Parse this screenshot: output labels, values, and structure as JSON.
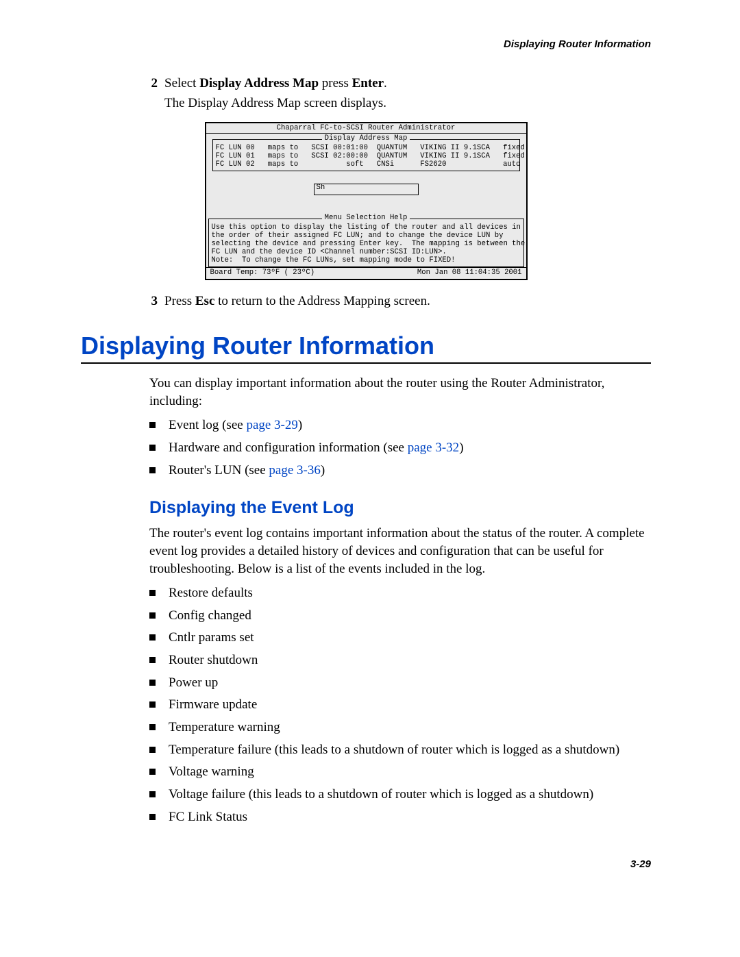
{
  "header": {
    "running_title": "Displaying Router Information"
  },
  "steps": {
    "s2": {
      "num": "2",
      "text_pre": "Select ",
      "bold1": "Display Address Map",
      "mid": " press ",
      "bold2": "Enter",
      "post": ".",
      "continue": "The Display Address Map screen displays."
    },
    "s3": {
      "num": "3",
      "text_pre": "Press ",
      "bold1": "Esc",
      "post": " to return to the Address Mapping screen."
    }
  },
  "terminal": {
    "title": "Chaparral FC-to-SCSI Router Administrator",
    "box_title": "Display Address Map",
    "rows": "FC LUN 00   maps to   SCSI 00:01:00  QUANTUM   VIKING II 9.1SCA   fixed\nFC LUN 01   maps to   SCSI 02:00:00  QUANTUM   VIKING II 9.1SCA   fixed\nFC LUN 02   maps to           soft   CNSi      FS2620             auto ",
    "sh": "Sh",
    "help_title": "Menu Selection Help",
    "help_text": "Use this option to display the listing of the router and all devices in\nthe order of their assigned FC LUN; and to change the device LUN by\nselecting the device and pressing Enter key.  The mapping is between the\nFC LUN and the device ID <Channel number:SCSI ID:LUN>.\nNote:  To change the FC LUNs, set mapping mode to FIXED!",
    "footer_left": "Board Temp:  73ºF ( 23ºC)",
    "footer_right": "Mon  Jan 08 11:04:35 2001"
  },
  "h1": "Displaying Router Information",
  "intro": "You can display important information about the router using the Router Administrator, including:",
  "intro_bullets": [
    {
      "text": "Event log (see ",
      "link": "page 3-29",
      "after": ")"
    },
    {
      "text": "Hardware and configuration information (see ",
      "link": "page 3-32",
      "after": ")"
    },
    {
      "text": "Router's LUN (see ",
      "link": "page 3-36",
      "after": ")"
    }
  ],
  "h2": "Displaying the Event Log",
  "eventlog_intro": "The router's event log contains important information about the status of the router. A complete event log provides a detailed history of devices and configuration that can be useful for troubleshooting. Below is a list of the events included in the log.",
  "event_bullets": [
    "Restore defaults",
    "Config changed",
    "Cntlr params set",
    "Router shutdown",
    "Power up",
    "Firmware update",
    "Temperature warning",
    "Temperature failure (this leads to a shutdown of router which is logged as a shutdown)",
    "Voltage warning",
    "Voltage failure (this leads to a shutdown of router which is logged as a shutdown)",
    "FC Link Status"
  ],
  "page_number": "3-29"
}
